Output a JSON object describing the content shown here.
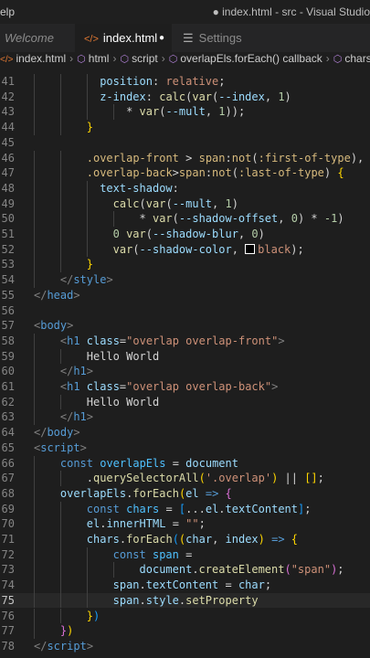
{
  "titlebar": {
    "menu": "Help",
    "menu_visible": "elp",
    "title": "● index.html - src - Visual Studio"
  },
  "tabs": [
    {
      "label": "Welcome",
      "active": false
    },
    {
      "label": "index.html",
      "active": true,
      "icon": "code-icon",
      "modified": true
    },
    {
      "label": "Settings",
      "active": false,
      "icon": "lines-icon"
    }
  ],
  "breadcrumb": [
    "index.html",
    "html",
    "script",
    "overlapEls.forEach() callback",
    "chars.f"
  ],
  "editor": {
    "current_line": 75,
    "lines": [
      {
        "n": "41",
        "tokens": [
          [
            "t-prop",
            "position"
          ],
          [
            "t-p",
            ": "
          ],
          [
            "t-val",
            "relative"
          ],
          [
            "t-p",
            ";"
          ]
        ],
        "indent": 10
      },
      {
        "n": "42",
        "tokens": [
          [
            "t-prop",
            "z-index"
          ],
          [
            "t-p",
            ": "
          ],
          [
            "t-fn",
            "calc"
          ],
          [
            "t-p",
            "("
          ],
          [
            "t-fn",
            "var"
          ],
          [
            "t-p",
            "("
          ],
          [
            "t-cssvar",
            "--index"
          ],
          [
            "t-p",
            ", "
          ],
          [
            "t-num",
            "1"
          ],
          [
            "t-p",
            ")"
          ]
        ],
        "indent": 10
      },
      {
        "n": "43",
        "tokens": [
          [
            "t-p",
            "* "
          ],
          [
            "t-fn",
            "var"
          ],
          [
            "t-p",
            "("
          ],
          [
            "t-cssvar",
            "--mult"
          ],
          [
            "t-p",
            ", "
          ],
          [
            "t-num",
            "1"
          ],
          [
            "t-p",
            "));"
          ]
        ],
        "indent": 14
      },
      {
        "n": "44",
        "tokens": [
          [
            "t-br1",
            "}"
          ]
        ],
        "indent": 8
      },
      {
        "n": "45",
        "tokens": [],
        "indent": 0
      },
      {
        "n": "46",
        "tokens": [
          [
            "t-sel",
            ".overlap-front"
          ],
          [
            "t-p",
            " > "
          ],
          [
            "t-sel",
            "span"
          ],
          [
            "t-p",
            ":"
          ],
          [
            "t-sel",
            "not"
          ],
          [
            "t-p",
            "("
          ],
          [
            "t-sel",
            ":first-of-type"
          ],
          [
            "t-p",
            "),"
          ]
        ],
        "indent": 8
      },
      {
        "n": "47",
        "tokens": [
          [
            "t-sel",
            ".overlap-back"
          ],
          [
            "t-p",
            ">"
          ],
          [
            "t-sel",
            "span"
          ],
          [
            "t-p",
            ":"
          ],
          [
            "t-sel",
            "not"
          ],
          [
            "t-p",
            "("
          ],
          [
            "t-sel",
            ":last-of-type"
          ],
          [
            "t-p",
            ") "
          ],
          [
            "t-br1",
            "{"
          ]
        ],
        "indent": 8
      },
      {
        "n": "48",
        "tokens": [
          [
            "t-prop",
            "text-shadow"
          ],
          [
            "t-p",
            ":"
          ]
        ],
        "indent": 10
      },
      {
        "n": "49",
        "tokens": [
          [
            "t-fn",
            "calc"
          ],
          [
            "t-p",
            "("
          ],
          [
            "t-fn",
            "var"
          ],
          [
            "t-p",
            "("
          ],
          [
            "t-cssvar",
            "--mult"
          ],
          [
            "t-p",
            ", "
          ],
          [
            "t-num",
            "1"
          ],
          [
            "t-p",
            ")"
          ]
        ],
        "indent": 12
      },
      {
        "n": "50",
        "tokens": [
          [
            "t-p",
            "* "
          ],
          [
            "t-fn",
            "var"
          ],
          [
            "t-p",
            "("
          ],
          [
            "t-cssvar",
            "--shadow-offset"
          ],
          [
            "t-p",
            ", "
          ],
          [
            "t-num",
            "0"
          ],
          [
            "t-p",
            ") * "
          ],
          [
            "t-num",
            "-1"
          ],
          [
            "t-p",
            ")"
          ]
        ],
        "indent": 16
      },
      {
        "n": "51",
        "tokens": [
          [
            "t-num",
            "0 "
          ],
          [
            "t-fn",
            "var"
          ],
          [
            "t-p",
            "("
          ],
          [
            "t-cssvar",
            "--shadow-blur"
          ],
          [
            "t-p",
            ", "
          ],
          [
            "t-num",
            "0"
          ],
          [
            "t-p",
            ")"
          ]
        ],
        "indent": 12
      },
      {
        "n": "52",
        "tokens": [
          [
            "t-fn",
            "var"
          ],
          [
            "t-p",
            "("
          ],
          [
            "t-cssvar",
            "--shadow-color"
          ],
          [
            "t-p",
            ", "
          ],
          [
            "swatch",
            ""
          ],
          [
            "t-val",
            "black"
          ],
          [
            "t-p",
            ");"
          ]
        ],
        "indent": 12
      },
      {
        "n": "53",
        "tokens": [
          [
            "t-br1",
            "}"
          ]
        ],
        "indent": 8
      },
      {
        "n": "54",
        "tokens": [
          [
            "t-punc",
            "</"
          ],
          [
            "t-tag",
            "style"
          ],
          [
            "t-punc",
            ">"
          ]
        ],
        "indent": 4
      },
      {
        "n": "55",
        "tokens": [
          [
            "t-punc",
            "</"
          ],
          [
            "t-tag",
            "head"
          ],
          [
            "t-punc",
            ">"
          ]
        ],
        "indent": 0
      },
      {
        "n": "56",
        "tokens": [],
        "indent": 0
      },
      {
        "n": "57",
        "tokens": [
          [
            "t-punc",
            "<"
          ],
          [
            "t-tag",
            "body"
          ],
          [
            "t-punc",
            ">"
          ]
        ],
        "indent": 0
      },
      {
        "n": "58",
        "tokens": [
          [
            "t-punc",
            "<"
          ],
          [
            "t-tag",
            "h1"
          ],
          [
            "t-p",
            " "
          ],
          [
            "t-attr",
            "class"
          ],
          [
            "t-p",
            "="
          ],
          [
            "t-str",
            "\"overlap overlap-front\""
          ],
          [
            "t-punc",
            ">"
          ]
        ],
        "indent": 4
      },
      {
        "n": "59",
        "tokens": [
          [
            "t-text",
            "Hello World"
          ]
        ],
        "indent": 8
      },
      {
        "n": "60",
        "tokens": [
          [
            "t-punc",
            "</"
          ],
          [
            "t-tag",
            "h1"
          ],
          [
            "t-punc",
            ">"
          ]
        ],
        "indent": 4
      },
      {
        "n": "61",
        "tokens": [
          [
            "t-punc",
            "<"
          ],
          [
            "t-tag",
            "h1"
          ],
          [
            "t-p",
            " "
          ],
          [
            "t-attr",
            "class"
          ],
          [
            "t-p",
            "="
          ],
          [
            "t-str",
            "\"overlap overlap-back\""
          ],
          [
            "t-punc",
            ">"
          ]
        ],
        "indent": 4
      },
      {
        "n": "62",
        "tokens": [
          [
            "t-text",
            "Hello World"
          ]
        ],
        "indent": 8
      },
      {
        "n": "63",
        "tokens": [
          [
            "t-punc",
            "</"
          ],
          [
            "t-tag",
            "h1"
          ],
          [
            "t-punc",
            ">"
          ]
        ],
        "indent": 4
      },
      {
        "n": "64",
        "tokens": [
          [
            "t-punc",
            "</"
          ],
          [
            "t-tag",
            "body"
          ],
          [
            "t-punc",
            ">"
          ]
        ],
        "indent": 0
      },
      {
        "n": "65",
        "tokens": [
          [
            "t-punc",
            "<"
          ],
          [
            "t-tag",
            "script"
          ],
          [
            "t-punc",
            ">"
          ]
        ],
        "indent": 0
      },
      {
        "n": "66",
        "tokens": [
          [
            "t-kw",
            "const "
          ],
          [
            "t-var",
            "overlapEls"
          ],
          [
            "t-p",
            " = "
          ],
          [
            "t-attr",
            "document"
          ]
        ],
        "indent": 4
      },
      {
        "n": "67",
        "tokens": [
          [
            "t-p",
            "."
          ],
          [
            "t-fn",
            "querySelectorAll"
          ],
          [
            "t-br1",
            "("
          ],
          [
            "t-str",
            "'.overlap'"
          ],
          [
            "t-br1",
            ")"
          ],
          [
            "t-p",
            " || "
          ],
          [
            "t-br1",
            "[]"
          ],
          [
            "t-p",
            ";"
          ]
        ],
        "indent": 8
      },
      {
        "n": "68",
        "tokens": [
          [
            "t-attr",
            "overlapEls"
          ],
          [
            "t-p",
            "."
          ],
          [
            "t-fn",
            "forEach"
          ],
          [
            "t-br1",
            "("
          ],
          [
            "t-attr",
            "el"
          ],
          [
            "t-kw",
            " => "
          ],
          [
            "t-br2",
            "{"
          ]
        ],
        "indent": 4
      },
      {
        "n": "69",
        "tokens": [
          [
            "t-kw",
            "const "
          ],
          [
            "t-var",
            "chars"
          ],
          [
            "t-p",
            " = "
          ],
          [
            "t-br3",
            "["
          ],
          [
            "t-p",
            "..."
          ],
          [
            "t-attr",
            "el"
          ],
          [
            "t-p",
            "."
          ],
          [
            "t-attr",
            "textContent"
          ],
          [
            "t-br3",
            "]"
          ],
          [
            "t-p",
            ";"
          ]
        ],
        "indent": 8
      },
      {
        "n": "70",
        "tokens": [
          [
            "t-attr",
            "el"
          ],
          [
            "t-p",
            "."
          ],
          [
            "t-attr",
            "innerHTML"
          ],
          [
            "t-p",
            " = "
          ],
          [
            "t-str",
            "\"\""
          ],
          [
            "t-p",
            ";"
          ]
        ],
        "indent": 8
      },
      {
        "n": "71",
        "tokens": [
          [
            "t-attr",
            "chars"
          ],
          [
            "t-p",
            "."
          ],
          [
            "t-fn",
            "forEach"
          ],
          [
            "t-br3",
            "("
          ],
          [
            "t-br1",
            "("
          ],
          [
            "t-attr",
            "char"
          ],
          [
            "t-p",
            ", "
          ],
          [
            "t-attr",
            "index"
          ],
          [
            "t-br1",
            ")"
          ],
          [
            "t-kw",
            " => "
          ],
          [
            "t-br1",
            "{"
          ]
        ],
        "indent": 8
      },
      {
        "n": "72",
        "tokens": [
          [
            "t-kw",
            "const "
          ],
          [
            "t-var",
            "span"
          ],
          [
            "t-p",
            " ="
          ]
        ],
        "indent": 12
      },
      {
        "n": "73",
        "tokens": [
          [
            "t-attr",
            "document"
          ],
          [
            "t-p",
            "."
          ],
          [
            "t-fn",
            "createElement"
          ],
          [
            "t-br2",
            "("
          ],
          [
            "t-str",
            "\"span\""
          ],
          [
            "t-br2",
            ")"
          ],
          [
            "t-p",
            ";"
          ]
        ],
        "indent": 16
      },
      {
        "n": "74",
        "tokens": [
          [
            "t-attr",
            "span"
          ],
          [
            "t-p",
            "."
          ],
          [
            "t-attr",
            "textContent"
          ],
          [
            "t-p",
            " = "
          ],
          [
            "t-attr",
            "char"
          ],
          [
            "t-p",
            ";"
          ]
        ],
        "indent": 12
      },
      {
        "n": "75",
        "tokens": [
          [
            "t-attr",
            "span"
          ],
          [
            "t-p",
            "."
          ],
          [
            "t-attr",
            "style"
          ],
          [
            "t-p",
            "."
          ],
          [
            "t-fn",
            "setProperty"
          ]
        ],
        "indent": 12
      },
      {
        "n": "76",
        "tokens": [
          [
            "t-br1",
            "}"
          ],
          [
            "t-br3",
            ")"
          ]
        ],
        "indent": 8
      },
      {
        "n": "77",
        "tokens": [
          [
            "t-br2",
            "}"
          ],
          [
            "t-br1",
            ")"
          ]
        ],
        "indent": 4
      },
      {
        "n": "78",
        "tokens": [
          [
            "t-punc",
            "</"
          ],
          [
            "t-tag",
            "script"
          ],
          [
            "t-punc",
            ">"
          ]
        ],
        "indent": 0
      }
    ]
  }
}
